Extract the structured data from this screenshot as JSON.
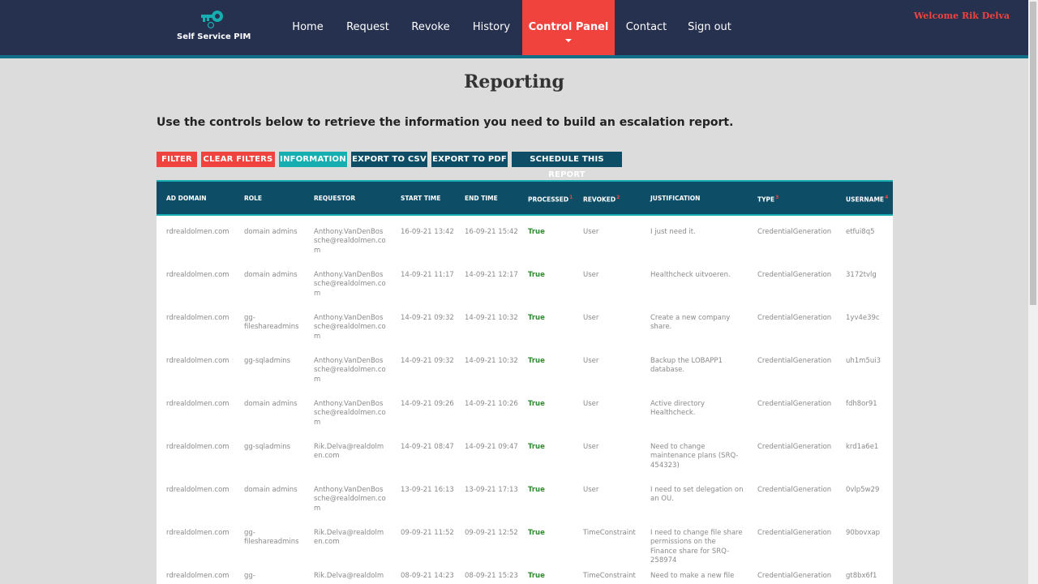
{
  "app": {
    "logo_text": "Self Service PIM",
    "welcome": "Welcome Rik Delva"
  },
  "nav": [
    {
      "label": "Home"
    },
    {
      "label": "Request"
    },
    {
      "label": "Revoke"
    },
    {
      "label": "History"
    },
    {
      "label": "Control Panel",
      "active": true
    },
    {
      "label": "Contact"
    },
    {
      "label": "Sign out"
    }
  ],
  "page": {
    "title": "Reporting",
    "subtitle": "Use the controls below to retrieve the information you need to build an escalation report."
  },
  "buttons": {
    "filter": "FILTER",
    "clear_filters": "CLEAR FILTERS",
    "information": "INFORMATION",
    "export_csv": "EXPORT TO CSV",
    "export_pdf": "EXPORT TO PDF",
    "schedule": "SCHEDULE THIS REPORT"
  },
  "table": {
    "headers": {
      "ad_domain": "AD DOMAIN",
      "role": "ROLE",
      "requestor": "REQUESTOR",
      "start_time": "START TIME",
      "end_time": "END TIME",
      "processed": "PROCESSED",
      "processed_note": "1",
      "revoked": "REVOKED",
      "revoked_note": "2",
      "justification": "JUSTIFICATION",
      "type": "TYPE",
      "type_note": "3",
      "username": "USERNAME",
      "username_note": "4"
    },
    "rows": [
      {
        "domain": "rdrealdolmen.com",
        "role": "domain admins",
        "requestor": [
          "Anthony.VanDenBos",
          "sche@realdolmen.co",
          "m"
        ],
        "start": "16-09-21 13:42",
        "end": "16-09-21 15:42",
        "processed": "True",
        "revoked": "User",
        "justification": [
          "I just need it."
        ],
        "type": "CredentialGeneration",
        "username": "etfui8q5"
      },
      {
        "domain": "rdrealdolmen.com",
        "role": "domain admins",
        "requestor": [
          "Anthony.VanDenBos",
          "sche@realdolmen.co",
          "m"
        ],
        "start": "14-09-21 11:17",
        "end": "14-09-21 12:17",
        "processed": "True",
        "revoked": "User",
        "justification": [
          "Healthcheck uitvoeren."
        ],
        "type": "CredentialGeneration",
        "username": "3172tvlg"
      },
      {
        "domain": "rdrealdolmen.com",
        "role": [
          "gg-",
          "fileshareadmins"
        ],
        "requestor": [
          "Anthony.VanDenBos",
          "sche@realdolmen.co",
          "m"
        ],
        "start": "14-09-21 09:32",
        "end": "14-09-21 10:32",
        "processed": "True",
        "revoked": "User",
        "justification": [
          "Create a new company",
          "share."
        ],
        "type": "CredentialGeneration",
        "username": "1yv4e39c"
      },
      {
        "domain": "rdrealdolmen.com",
        "role": "gg-sqladmins",
        "requestor": [
          "Anthony.VanDenBos",
          "sche@realdolmen.co",
          "m"
        ],
        "start": "14-09-21 09:32",
        "end": "14-09-21 10:32",
        "processed": "True",
        "revoked": "User",
        "justification": [
          "Backup the LOBAPP1",
          "database."
        ],
        "type": "CredentialGeneration",
        "username": "uh1m5ui3"
      },
      {
        "domain": "rdrealdolmen.com",
        "role": "domain admins",
        "requestor": [
          "Anthony.VanDenBos",
          "sche@realdolmen.co",
          "m"
        ],
        "start": "14-09-21 09:26",
        "end": "14-09-21 10:26",
        "processed": "True",
        "revoked": "User",
        "justification": [
          "Active directory",
          "Healthcheck."
        ],
        "type": "CredentialGeneration",
        "username": "fdh8or91"
      },
      {
        "domain": "rdrealdolmen.com",
        "role": "gg-sqladmins",
        "requestor": [
          "Rik.Delva@realdolm",
          "en.com"
        ],
        "start": "14-09-21 08:47",
        "end": "14-09-21 09:47",
        "processed": "True",
        "revoked": "User",
        "justification": [
          "Need to change",
          "maintenance plans (SRQ-",
          "454323)"
        ],
        "type": "CredentialGeneration",
        "username": "krd1a6e1"
      },
      {
        "domain": "rdrealdolmen.com",
        "role": "domain admins",
        "requestor": [
          "Anthony.VanDenBos",
          "sche@realdolmen.co",
          "m"
        ],
        "start": "13-09-21 16:13",
        "end": "13-09-21 17:13",
        "processed": "True",
        "revoked": "User",
        "justification": [
          "I need to set delegation on",
          "an OU."
        ],
        "type": "CredentialGeneration",
        "username": "0vlp5w29"
      },
      {
        "domain": "rdrealdolmen.com",
        "role": [
          "gg-",
          "fileshareadmins"
        ],
        "requestor": [
          "Rik.Delva@realdolm",
          "en.com"
        ],
        "start": "09-09-21 11:52",
        "end": "09-09-21 12:52",
        "processed": "True",
        "revoked": "TimeConstraint",
        "justification": [
          "I need to change file share",
          "permissions on the",
          "Finance share for SRQ-",
          "258974"
        ],
        "type": "CredentialGeneration",
        "username": "90bovxap"
      },
      {
        "domain": "rdrealdolmen.com",
        "role": [
          "gg-"
        ],
        "requestor": [
          "Rik.Delva@realdolm"
        ],
        "start": "08-09-21 14:23",
        "end": "08-09-21 15:23",
        "processed": "True",
        "revoked": "TimeConstraint",
        "justification": [
          "Need to make a new file"
        ],
        "type": "CredentialGeneration",
        "username": "gt8bx6f1"
      }
    ]
  },
  "colors": {
    "header_bg": "#26304f",
    "accent_red": "#f0433e",
    "accent_teal": "#16aeb1",
    "table_head": "#0d4d66",
    "true_green": "#2e8b2e"
  },
  "icons": {
    "logo": "key-icon",
    "active_caret": "caret-down-icon"
  }
}
